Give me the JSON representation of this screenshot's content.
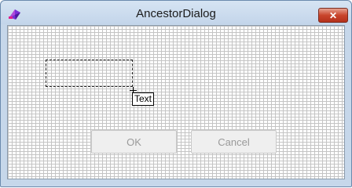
{
  "window": {
    "title": "AncestorDialog",
    "close_symbol": "✕",
    "app_icon": "app-icon",
    "close_color": "#c9452c"
  },
  "canvas": {
    "label_text": "Text",
    "cursor_icon": "crosshair-icon"
  },
  "buttons": {
    "ok_label": "OK",
    "cancel_label": "Cancel"
  }
}
